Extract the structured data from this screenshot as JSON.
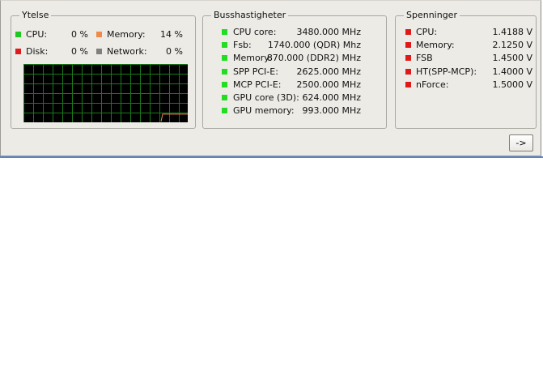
{
  "performance": {
    "title": "Ytelse",
    "items": [
      {
        "label": "CPU:",
        "value": "0 %",
        "color": "#1ec81e"
      },
      {
        "label": "Memory:",
        "value": "14 %",
        "color": "#f08a4b"
      },
      {
        "label": "Disk:",
        "value": "0 %",
        "color": "#e01a1a"
      },
      {
        "label": "Network:",
        "value": "0 %",
        "color": "#808080"
      }
    ],
    "graph": {
      "grid_color": "#1a7a1a",
      "line_color": "#f08a4b",
      "memory_level_percent": 14
    }
  },
  "bus_speeds": {
    "title": "Busshastigheter",
    "items": [
      {
        "label": "CPU core:",
        "value": "3480.000 MHz"
      },
      {
        "label": "Fsb:",
        "value": "1740.000 (QDR) Mhz"
      },
      {
        "label": "Memory:",
        "value": "870.000  (DDR2) MHz"
      },
      {
        "label": "SPP PCI-E:",
        "value": "2625.000 MHz"
      },
      {
        "label": "MCP PCI-E:",
        "value": "2500.000 MHz"
      },
      {
        "label": "GPU core (3D):",
        "value": "624.000 MHz"
      },
      {
        "label": "GPU memory:",
        "value": "993.000 MHz"
      }
    ],
    "indicator_color": "#22dd22"
  },
  "voltages": {
    "title": "Spenninger",
    "items": [
      {
        "label": "CPU:",
        "value": "1.4188 V"
      },
      {
        "label": "Memory:",
        "value": "2.1250 V"
      },
      {
        "label": "FSB",
        "value": "1.4500 V"
      },
      {
        "label": "HT(SPP-MCP):",
        "value": "1.4000 V"
      },
      {
        "label": "nForce:",
        "value": "1.5000 V"
      }
    ],
    "indicator_color": "#e01a1a"
  },
  "next_button": {
    "label": "->"
  }
}
